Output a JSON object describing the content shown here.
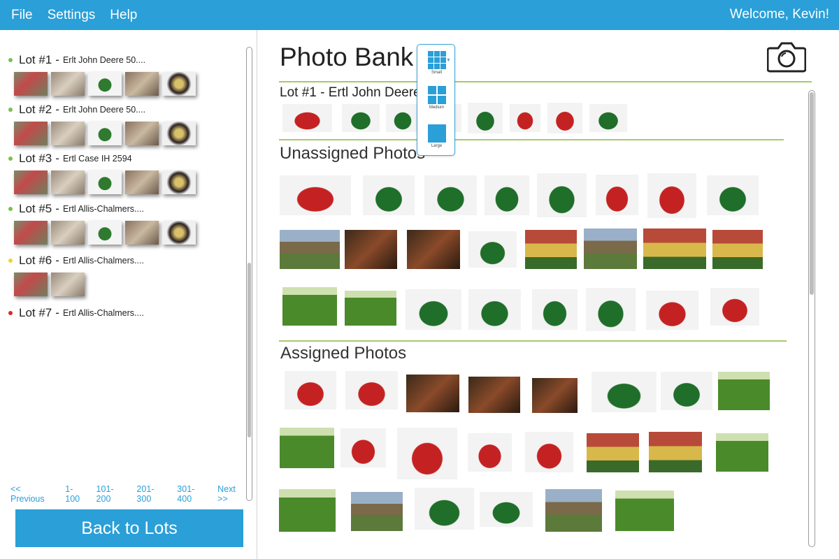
{
  "menu": {
    "file": "File",
    "settings": "Settings",
    "help": "Help",
    "welcome": "Welcome, Kevin!"
  },
  "lots": [
    {
      "num": "Lot #1",
      "name": "Erlt John Deere 50....",
      "status": "green",
      "thumbs": 5
    },
    {
      "num": "Lot #2",
      "name": "Erlt John Deere 50....",
      "status": "green",
      "thumbs": 5
    },
    {
      "num": "Lot #3",
      "name": "Ertl Case IH 2594",
      "status": "green",
      "thumbs": 5
    },
    {
      "num": "Lot #5",
      "name": "Ertl Allis-Chalmers....",
      "status": "green",
      "thumbs": 5
    },
    {
      "num": "Lot #6",
      "name": "Ertl Allis-Chalmers....",
      "status": "yellow",
      "thumbs": 2
    },
    {
      "num": "Lot #7",
      "name": "Ertl Allis-Chalmers....",
      "status": "red",
      "thumbs": 0
    }
  ],
  "status_colors": {
    "green": "#7cc04b",
    "yellow": "#f2d22c",
    "red": "#e2242a"
  },
  "pager": {
    "prev": "<< Previous",
    "p1": "1-100",
    "p2": "101-200",
    "p3": "201-300",
    "p4": "301-400",
    "next": "Next >>"
  },
  "back_button": "Back to Lots",
  "main": {
    "title": "Photo Bank",
    "current_lot": "Lot #1 - Ertl John Deere",
    "unassigned_title": "Unassigned Photos",
    "assigned_title": "Assigned Photos"
  },
  "size_menu": {
    "small": "Small",
    "medium": "Medium",
    "large": "Large"
  },
  "colors": {
    "accent": "#2a9fd8",
    "divider": "#a9c96a"
  }
}
